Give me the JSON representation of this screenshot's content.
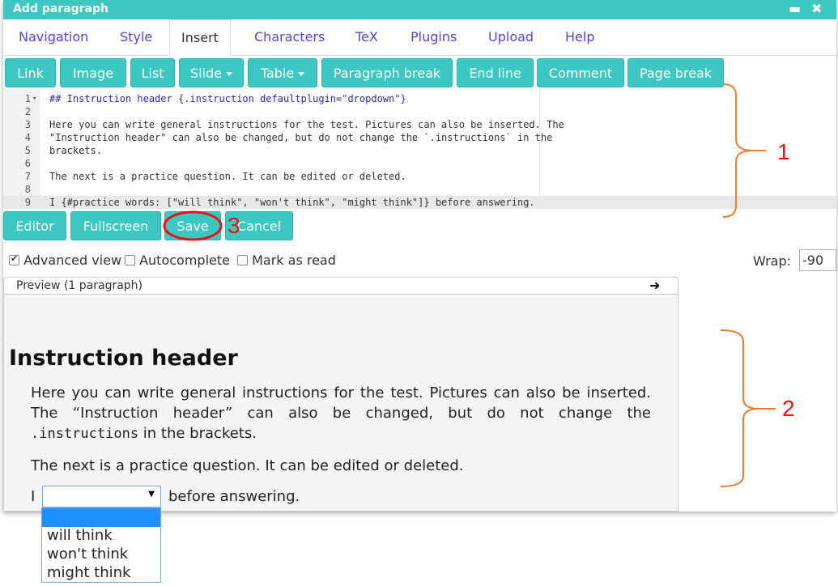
{
  "window": {
    "title": "Add paragraph",
    "minimize": "▬",
    "close": "✖"
  },
  "tabs": [
    {
      "label": "Navigation"
    },
    {
      "label": "Style"
    },
    {
      "label": "Insert",
      "active": true
    },
    {
      "label": "Characters"
    },
    {
      "label": "TeX"
    },
    {
      "label": "Plugins"
    },
    {
      "label": "Upload"
    },
    {
      "label": "Help"
    }
  ],
  "toolbar": {
    "link": "Link",
    "image": "Image",
    "list": "List",
    "slide": "Slide",
    "table": "Table",
    "paragraph_break": "Paragraph break",
    "end_line": "End line",
    "comment": "Comment",
    "page_break": "Page break"
  },
  "editor": {
    "lines": [
      {
        "n": "1",
        "text": "## Instruction header {.instruction defaultplugin=\"dropdown\"}"
      },
      {
        "n": "2",
        "text": ""
      },
      {
        "n": "3",
        "text": "Here you can write general instructions for the test. Pictures can also be inserted. The"
      },
      {
        "n": "4",
        "text": "\"Instruction header\" can also be changed, but do not change the `.instructions` in the"
      },
      {
        "n": "5",
        "text": "brackets."
      },
      {
        "n": "6",
        "text": ""
      },
      {
        "n": "7",
        "text": "The next is a practice question. It can be edited or deleted."
      },
      {
        "n": "8",
        "text": ""
      },
      {
        "n": "9",
        "text": "I {#practice words: [\"will think\", \"won't think\", \"might think\"]} before answering."
      }
    ]
  },
  "actions": {
    "editor": "Editor",
    "fullscreen": "Fullscreen",
    "save": "Save",
    "cancel": "Cancel"
  },
  "options": {
    "advanced_view": {
      "label": "Advanced view",
      "checked": true
    },
    "autocomplete": {
      "label": "Autocomplete",
      "checked": false
    },
    "mark_as_read": {
      "label": "Mark as read",
      "checked": false
    },
    "wrap_label": "Wrap:",
    "wrap_value": "-90"
  },
  "preview": {
    "label": "Preview (1 paragraph)",
    "arrow": "➜",
    "heading": "Instruction header",
    "para1_a": "Here you can write general instructions for the test. Pictures can also be inserted. The “Instruction header” can also be changed, but do not change the ",
    "para1_code": ".instructions",
    "para1_b": " in the brackets.",
    "para2": "The next is a practice question. It can be edited or deleted.",
    "q_prefix": "I",
    "q_suffix": "before answering.",
    "dropdown_options": [
      "",
      "will think",
      "won't think",
      "might think"
    ]
  },
  "annotations": {
    "one": "1",
    "two": "2",
    "three": "3",
    "color": "#e11"
  }
}
